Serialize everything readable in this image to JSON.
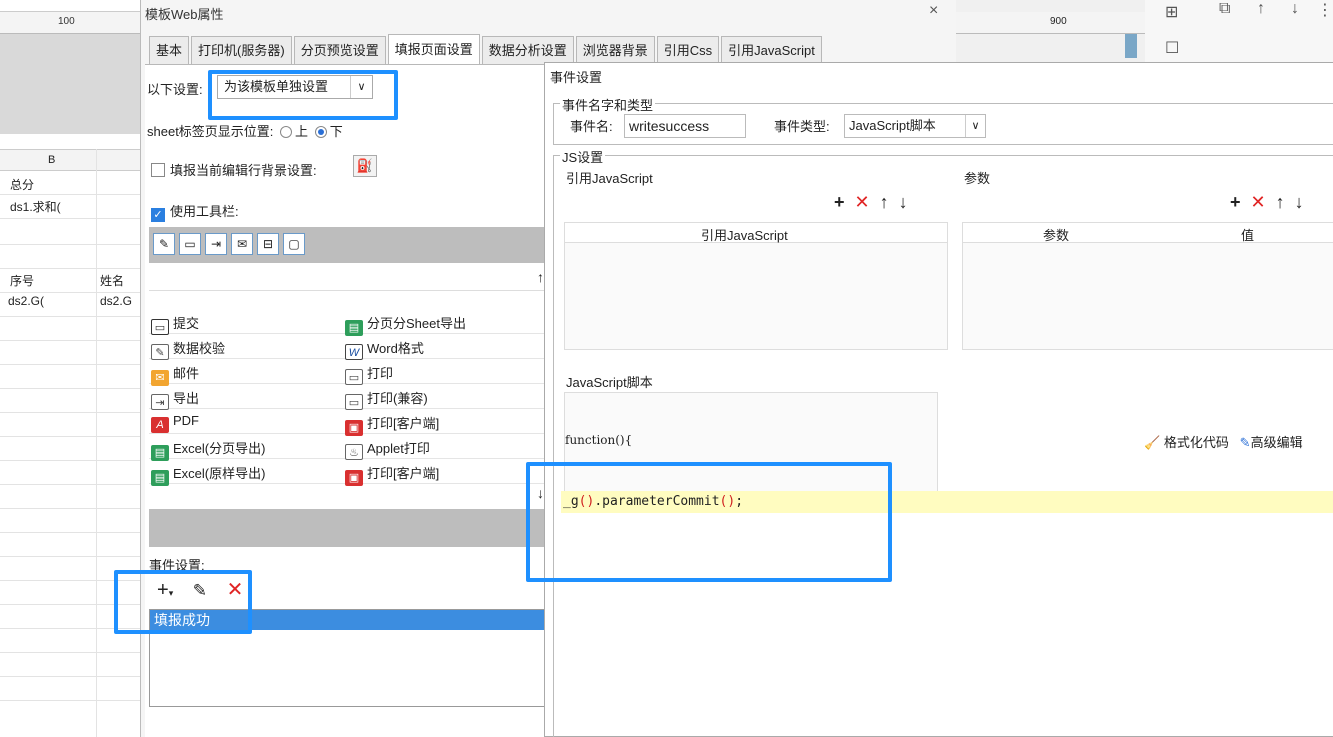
{
  "background": {
    "ruler_left": "100",
    "ruler_right": "900",
    "column_b": "B",
    "cells": [
      {
        "text": "总分"
      },
      {
        "text": "ds1.求和("
      },
      {
        "text": "序号"
      },
      {
        "text": "姓名"
      },
      {
        "text": "ds2.G("
      },
      {
        "text": "ds2.G"
      }
    ]
  },
  "dialog": {
    "title": "模板Web属性",
    "close": "×",
    "tabs": [
      "基本",
      "打印机(服务器)",
      "分页预览设置",
      "填报页面设置",
      "数据分析设置",
      "浏览器背景",
      "引用Css",
      "引用JavaScript"
    ],
    "following_settings_label": "以下设置:",
    "following_settings_value": "为该模板单独设置",
    "sheet_tab_label": "sheet标签页显示位置:",
    "sheet_tab_top": "上",
    "sheet_tab_bottom": "下",
    "edit_row_bg_label": "填报当前编辑行背景设置:",
    "use_toolbar_label": "使用工具栏:",
    "buttons_left": [
      "提交",
      "数据校验",
      "邮件",
      "导出",
      "PDF",
      "Excel(分页导出)",
      "Excel(原样导出)"
    ],
    "buttons_right": [
      "分页分Sheet导出",
      "Word格式",
      "打印",
      "打印(兼容)",
      "打印[客户端]",
      "Applet打印",
      "打印[客户端]"
    ],
    "events_label": "事件设置:",
    "event_items": [
      "填报成功"
    ]
  },
  "event_dialog": {
    "title": "事件设置",
    "name_type_legend": "事件名字和类型",
    "event_name_label": "事件名:",
    "event_name_value": "writesuccess",
    "event_type_label": "事件类型:",
    "event_type_value": "JavaScript脚本",
    "js_legend": "JS设置",
    "ref_js_label": "引用JavaScript",
    "params_label": "参数",
    "ref_js_col": "引用JavaScript",
    "params_col": "参数",
    "value_col": "值",
    "js_script_label": "JavaScript脚本",
    "function_text": "function(){",
    "format_code": "格式化代码",
    "advanced_edit": "高级编辑",
    "code_line": "_g().parameterCommit();"
  },
  "colors": {
    "highlight": "#1e90ff",
    "selection": "#3c8de0",
    "code_bg": "#fffcc0"
  }
}
